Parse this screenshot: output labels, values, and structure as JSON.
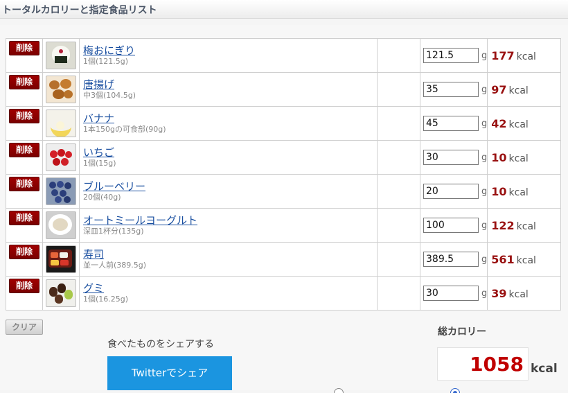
{
  "header": {
    "title": "トータルカロリーと指定食品リスト"
  },
  "buttons": {
    "delete_label": "削除",
    "clear_label": "クリア"
  },
  "units": {
    "gram": "g",
    "kcal": "kcal"
  },
  "foods": [
    {
      "name": "梅おにぎり",
      "portion": "1個(121.5g)",
      "amount": "121.5",
      "calories": "177",
      "icon": "onigiri-icon"
    },
    {
      "name": "唐揚げ",
      "portion": "中3個(104.5g)",
      "amount": "35",
      "calories": "97",
      "icon": "karaage-icon"
    },
    {
      "name": "バナナ",
      "portion": "1本150gの可食部(90g)",
      "amount": "45",
      "calories": "42",
      "icon": "banana-icon"
    },
    {
      "name": "いちご",
      "portion": "1個(15g)",
      "amount": "30",
      "calories": "10",
      "icon": "strawberry-icon"
    },
    {
      "name": "ブルーベリー",
      "portion": "20個(40g)",
      "amount": "20",
      "calories": "10",
      "icon": "blueberry-icon"
    },
    {
      "name": "オートミールヨーグルト",
      "portion": "深皿1杯分(135g)",
      "amount": "100",
      "calories": "122",
      "icon": "oatmeal-yogurt-icon"
    },
    {
      "name": "寿司",
      "portion": "並一人前(389.5g)",
      "amount": "389.5",
      "calories": "561",
      "icon": "sushi-icon"
    },
    {
      "name": "グミ",
      "portion": "1個(16.25g)",
      "amount": "30",
      "calories": "39",
      "icon": "gummy-icon"
    }
  ],
  "share": {
    "label": "食べたものをシェアする",
    "twitter_label": "Twitterでシェア"
  },
  "total": {
    "label": "総カロリー",
    "value": "1058",
    "unit": "kcal"
  },
  "colors": {
    "delete": "#8b0000",
    "calorie": "#991111",
    "total": "#c00000",
    "twitter": "#1b95e0",
    "link": "#1a4fa0"
  }
}
